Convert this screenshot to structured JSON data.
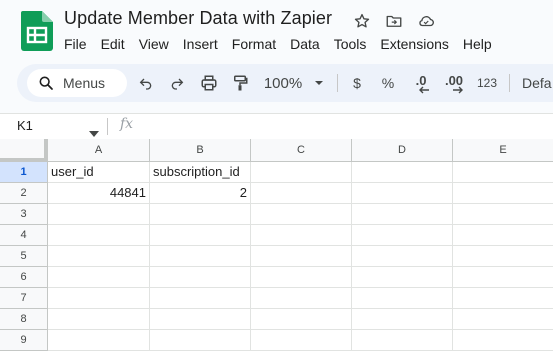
{
  "doc": {
    "title": "Update Member Data with Zapier",
    "icons": [
      "star-icon",
      "move-to-folder-icon",
      "cloud-saved-icon"
    ]
  },
  "menu": [
    "File",
    "Edit",
    "View",
    "Insert",
    "Format",
    "Data",
    "Tools",
    "Extensions",
    "Help"
  ],
  "toolbar": {
    "search_label": "Menus",
    "zoom": "100%",
    "currency": "$",
    "percent": "%",
    "decrease_decimal": ".0",
    "increase_decimal": ".00",
    "number_format": "123",
    "font_partial": "Defa"
  },
  "formula_bar": {
    "name_box": "K1",
    "fx": "fx",
    "value": ""
  },
  "columns": [
    "A",
    "B",
    "C",
    "D",
    "E"
  ],
  "rows": [
    "1",
    "2",
    "3",
    "4",
    "5",
    "6",
    "7",
    "8",
    "9"
  ],
  "cells": {
    "A1": "user_id",
    "B1": "subscription_id",
    "A2": "44841",
    "B2": "2"
  },
  "colors": {
    "accent": "#0b57d0",
    "selected_row_header": "#d3e3fd",
    "toolbar_bg": "#edf2fa",
    "sheets_green": "#0f9d58"
  }
}
